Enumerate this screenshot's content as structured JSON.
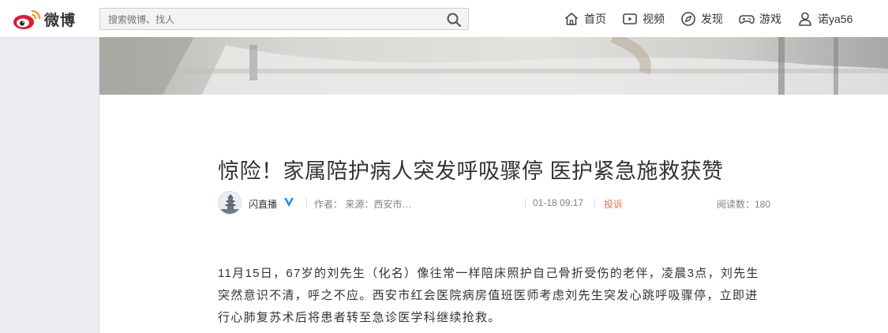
{
  "header": {
    "logo_text": "微博",
    "search_placeholder": "搜索微博、找人",
    "nav": [
      {
        "label": "首页",
        "icon": "home-icon"
      },
      {
        "label": "视频",
        "icon": "video-icon"
      },
      {
        "label": "发现",
        "icon": "discover-icon"
      },
      {
        "label": "游戏",
        "icon": "game-icon"
      },
      {
        "label": "诺ya56",
        "icon": "user-icon"
      }
    ]
  },
  "article": {
    "title": "惊险！家属陪护病人突发呼吸骤停 医护紧急施救获赞",
    "author": "闪直播",
    "byline": "作者：  来源：西安市…",
    "time": "01-18 09:17",
    "complain": "投诉",
    "reads": "阅读数：180",
    "paragraph": "11月15日，67岁的刘先生（化名）像往常一样陪床照护自己骨折受伤的老伴，凌晨3点，刘先生突然意识不清，呼之不应。西安市红会医院病房值班医师考虑刘先生突发心跳呼吸骤停，立即进行心肺复苏术后将患者转至急诊医学科继续抢救。"
  },
  "colors": {
    "accent": "#eb7350",
    "verified": "#1a8fe0",
    "brand_red": "#e6162d",
    "brand_yellow": "#ff9933"
  }
}
